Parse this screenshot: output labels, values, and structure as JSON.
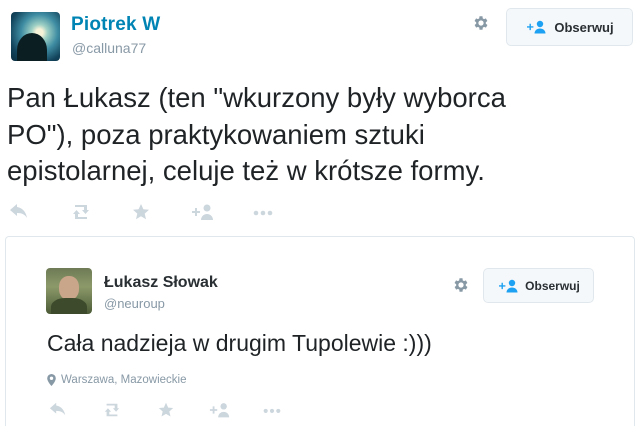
{
  "tweet": {
    "author_name": "Piotrek W",
    "author_handle": "@calluna77",
    "follow_label": "Obserwuj",
    "text": "Pan Łukasz (ten \"wkurzony były wyborca\nPO\"), poza praktykowaniem sztuki\nepistolarnej, celuje też w krótsze formy.",
    "actions": [
      "reply-icon",
      "retweet-icon",
      "favorite-icon",
      "follow-icon",
      "more-icon"
    ]
  },
  "quoted": {
    "author_name": "Łukasz Słowak",
    "author_handle": "@neuroup",
    "follow_label": "Obserwuj",
    "text": "Cała nadzieja w drugim Tupolewie :)))",
    "location": "Warszawa, Mazowieckie"
  },
  "colors": {
    "link_blue": "#0084b4",
    "muted": "#8899a6",
    "action_icon": "#ccd6dd",
    "follow_icon": "#1da1f2"
  }
}
